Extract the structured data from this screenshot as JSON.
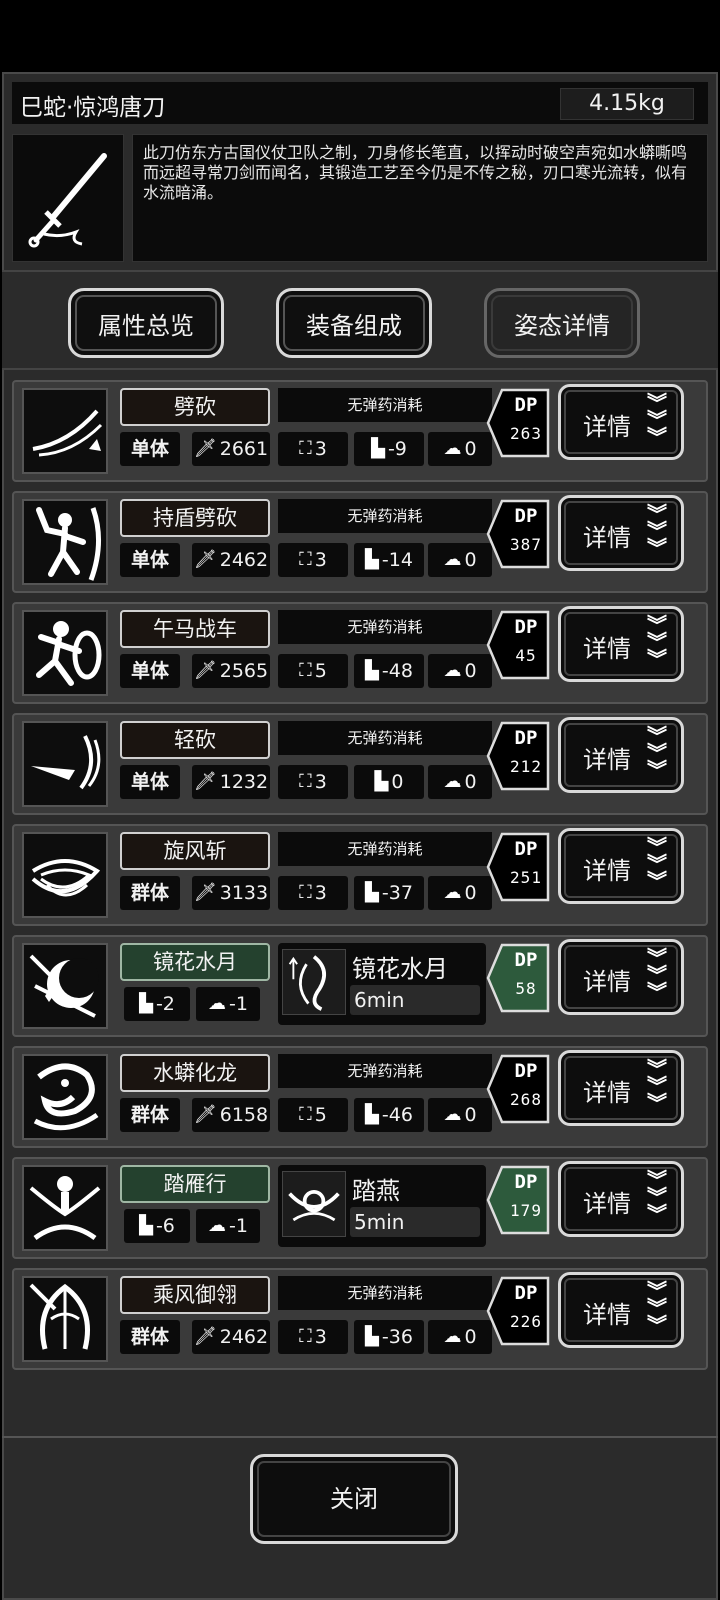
{
  "weapon": {
    "title": "巳蛇·惊鸿唐刀",
    "weight": "4.15kg",
    "icon": "sword-icon",
    "description": "此刀仿东方古国仪仗卫队之制，刀身修长笔直，以挥动时破空声宛如水蟒嘶鸣而远超寻常刀剑而闻名，其锻造工艺至今仍是不传之秘，刃口寒光流转，似有水流暗涌。"
  },
  "tabs": [
    {
      "label": "属性总览",
      "active": false
    },
    {
      "label": "装备组成",
      "active": false
    },
    {
      "label": "姿态详情",
      "active": true
    }
  ],
  "skills": [
    {
      "name": "劈砍",
      "type": "normal",
      "ammo": "无弹药消耗",
      "target": "单体",
      "power": "2661",
      "hits": "3",
      "move": "-9",
      "brain": "0",
      "dp_label": "DP",
      "dp": "263",
      "detail": "详情",
      "icon": "slash-icon"
    },
    {
      "name": "持盾劈砍",
      "type": "normal",
      "ammo": "无弹药消耗",
      "target": "单体",
      "power": "2462",
      "hits": "3",
      "move": "-14",
      "brain": "0",
      "dp_label": "DP",
      "dp": "387",
      "detail": "详情",
      "icon": "shield-slash-icon"
    },
    {
      "name": "午马战车",
      "type": "normal",
      "ammo": "无弹药消耗",
      "target": "单体",
      "power": "2565",
      "hits": "5",
      "move": "-48",
      "brain": "0",
      "dp_label": "DP",
      "dp": "45",
      "detail": "详情",
      "icon": "charge-icon"
    },
    {
      "name": "轻砍",
      "type": "normal",
      "ammo": "无弹药消耗",
      "target": "单体",
      "power": "1232",
      "hits": "3",
      "move": "0",
      "brain": "0",
      "dp_label": "DP",
      "dp": "212",
      "detail": "详情",
      "icon": "light-slash-icon"
    },
    {
      "name": "旋风斩",
      "type": "normal",
      "ammo": "无弹药消耗",
      "target": "群体",
      "power": "3133",
      "hits": "3",
      "move": "-37",
      "brain": "0",
      "dp_label": "DP",
      "dp": "251",
      "detail": "详情",
      "icon": "whirlwind-icon"
    },
    {
      "name": "镜花水月",
      "type": "stance",
      "move": "-2",
      "brain": "-1",
      "stance_name": "镜花水月",
      "stance_time": "6min",
      "dp_label": "DP",
      "dp": "58",
      "detail": "详情",
      "icon": "mirror-moon-icon"
    },
    {
      "name": "水蟒化龙",
      "type": "normal",
      "ammo": "无弹药消耗",
      "target": "群体",
      "power": "6158",
      "hits": "5",
      "move": "-46",
      "brain": "0",
      "dp_label": "DP",
      "dp": "268",
      "detail": "详情",
      "icon": "serpent-dragon-icon"
    },
    {
      "name": "踏雁行",
      "type": "stance",
      "move": "-6",
      "brain": "-1",
      "stance_name": "踏燕",
      "stance_time": "5min",
      "dp_label": "DP",
      "dp": "179",
      "detail": "详情",
      "icon": "swallow-step-icon"
    },
    {
      "name": "乘风御翎",
      "type": "normal",
      "ammo": "无弹药消耗",
      "target": "群体",
      "power": "2462",
      "hits": "3",
      "move": "-36",
      "brain": "0",
      "dp_label": "DP",
      "dp": "226",
      "detail": "详情",
      "icon": "wind-feather-icon"
    }
  ],
  "close_label": "关闭",
  "colors": {
    "panel": "#2b2b2b",
    "row": "#3a3a3a",
    "stance_green": "#24412e",
    "dp_green": "#2d5a3c"
  }
}
